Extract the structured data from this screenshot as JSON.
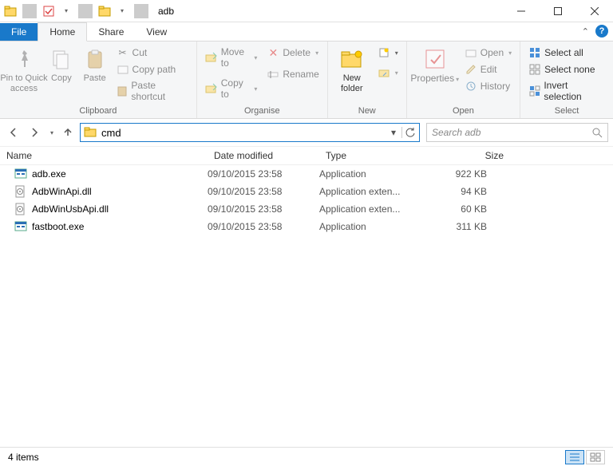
{
  "window": {
    "title": "adb"
  },
  "tabs": {
    "file": "File",
    "home": "Home",
    "share": "Share",
    "view": "View"
  },
  "ribbon": {
    "clipboard": {
      "label": "Clipboard",
      "pin": "Pin to Quick\naccess",
      "copy": "Copy",
      "paste": "Paste",
      "cut": "Cut",
      "copypath": "Copy path",
      "pasteshortcut": "Paste shortcut"
    },
    "organise": {
      "label": "Organise",
      "moveto": "Move to",
      "copyto": "Copy to",
      "delete": "Delete",
      "rename": "Rename"
    },
    "new": {
      "label": "New",
      "newfolder": "New\nfolder"
    },
    "open": {
      "label": "Open",
      "properties": "Properties",
      "open": "Open",
      "edit": "Edit",
      "history": "History"
    },
    "select": {
      "label": "Select",
      "selectall": "Select all",
      "selectnone": "Select none",
      "invert": "Invert selection"
    }
  },
  "address": {
    "value": "cmd"
  },
  "search": {
    "placeholder": "Search adb"
  },
  "columns": {
    "name": "Name",
    "date": "Date modified",
    "type": "Type",
    "size": "Size"
  },
  "files": [
    {
      "name": "adb.exe",
      "date": "09/10/2015 23:58",
      "type": "Application",
      "size": "922 KB",
      "icon": "exe"
    },
    {
      "name": "AdbWinApi.dll",
      "date": "09/10/2015 23:58",
      "type": "Application exten...",
      "size": "94 KB",
      "icon": "dll"
    },
    {
      "name": "AdbWinUsbApi.dll",
      "date": "09/10/2015 23:58",
      "type": "Application exten...",
      "size": "60 KB",
      "icon": "dll"
    },
    {
      "name": "fastboot.exe",
      "date": "09/10/2015 23:58",
      "type": "Application",
      "size": "311 KB",
      "icon": "exe"
    }
  ],
  "status": {
    "count": "4 items"
  }
}
